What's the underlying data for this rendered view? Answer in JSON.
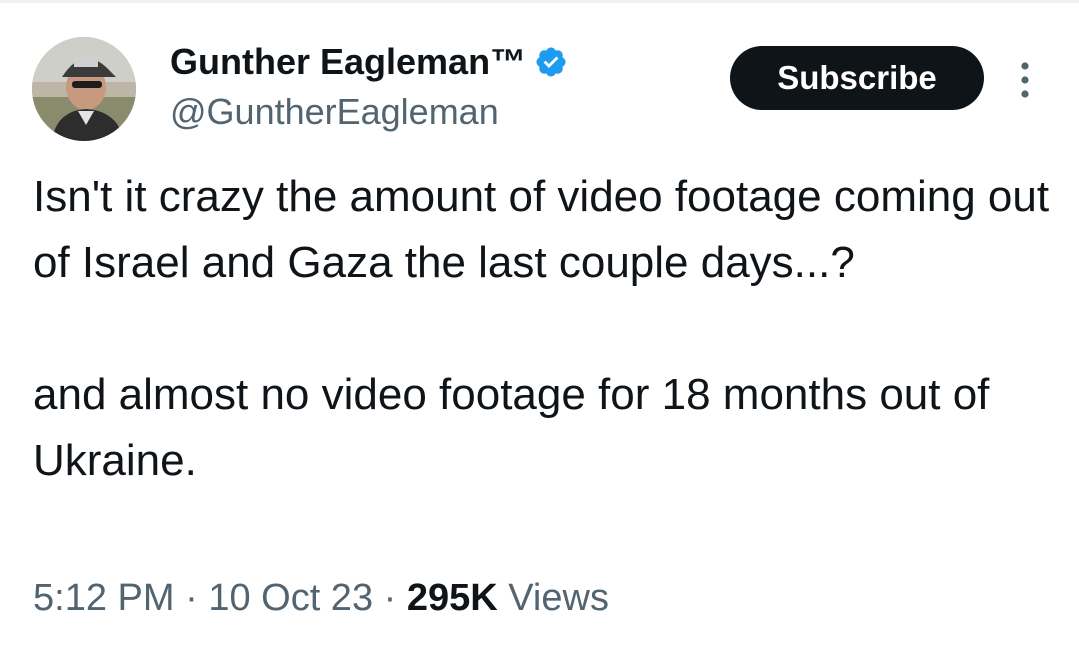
{
  "author": {
    "display_name": "Gunther Eagleman™",
    "handle": "@GuntherEagleman",
    "verified_icon": "verified-badge-icon",
    "avatar_icon": "avatar-photo"
  },
  "actions": {
    "subscribe_label": "Subscribe",
    "more_icon": "more-vertical-icon"
  },
  "tweet": {
    "paragraph_1": "Isn't it crazy the amount of video footage coming out of Israel and Gaza the last couple days...?",
    "paragraph_2": "and almost no video footage for 18 months out of Ukraine."
  },
  "meta": {
    "time": "5:12 PM",
    "date": "10 Oct 23",
    "separator": "·",
    "views_count": "295K",
    "views_label": "Views"
  },
  "colors": {
    "text_primary": "#0f1419",
    "text_secondary": "#536471",
    "verified_blue": "#1d9bf0",
    "button_bg": "#0f1419",
    "button_text": "#ffffff"
  }
}
